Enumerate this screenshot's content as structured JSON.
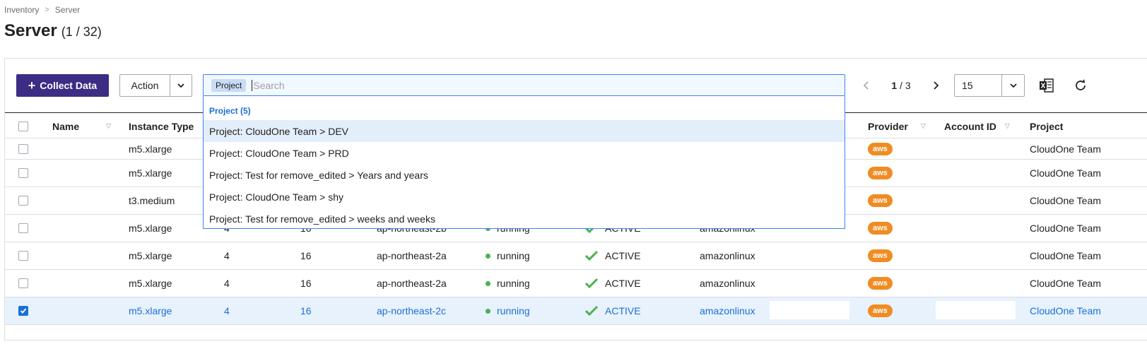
{
  "breadcrumb": [
    "Inventory",
    "Server"
  ],
  "page": {
    "title": "Server",
    "count": "(1 / 32)"
  },
  "toolbar": {
    "collect_label": "Collect Data",
    "action_label": "Action",
    "page_current": "1",
    "page_total": "/ 3",
    "page_size": "15"
  },
  "search": {
    "tag": "Project",
    "placeholder": "Search",
    "dropdown_header": "Project (5)",
    "options": [
      "Project: CloudOne Team > DEV",
      "Project: CloudOne Team > PRD",
      "Project: Test for remove_edited > Years and years",
      "Project: CloudOne Team > shy",
      "Project: Test for remove_edited > weeks and weeks"
    ]
  },
  "columns": {
    "name": "Name",
    "instance_type": "Instance Type",
    "provider": "Provider",
    "account_id": "Account ID",
    "project": "Project"
  },
  "rows": [
    {
      "instance_type": "m5.xlarge",
      "core": "",
      "memory": "",
      "region": "",
      "state": "",
      "lifecycle": "",
      "os": "",
      "provider": "aws",
      "project": "CloudOne Team",
      "checked": false
    },
    {
      "instance_type": "m5.xlarge",
      "core": "",
      "memory": "",
      "region": "",
      "state": "",
      "lifecycle": "",
      "os": "",
      "provider": "aws",
      "project": "CloudOne Team",
      "checked": false
    },
    {
      "instance_type": "t3.medium",
      "core": "",
      "memory": "",
      "region": "",
      "state": "",
      "lifecycle": "",
      "os": "",
      "provider": "aws",
      "project": "CloudOne Team",
      "checked": false
    },
    {
      "instance_type": "m5.xlarge",
      "core": "4",
      "memory": "16",
      "region": "ap-northeast-2b",
      "state": "running",
      "lifecycle": "ACTIVE",
      "os": "amazonlinux",
      "provider": "aws",
      "project": "CloudOne Team",
      "checked": false
    },
    {
      "instance_type": "m5.xlarge",
      "core": "4",
      "memory": "16",
      "region": "ap-northeast-2a",
      "state": "running",
      "lifecycle": "ACTIVE",
      "os": "amazonlinux",
      "provider": "aws",
      "project": "CloudOne Team",
      "checked": false
    },
    {
      "instance_type": "m5.xlarge",
      "core": "4",
      "memory": "16",
      "region": "ap-northeast-2a",
      "state": "running",
      "lifecycle": "ACTIVE",
      "os": "amazonlinux",
      "provider": "aws",
      "project": "CloudOne Team",
      "checked": false
    },
    {
      "instance_type": "m5.xlarge",
      "core": "4",
      "memory": "16",
      "region": "ap-northeast-2c",
      "state": "running",
      "lifecycle": "ACTIVE",
      "os": "amazonlinux",
      "provider": "aws",
      "project": "CloudOne Team",
      "checked": true
    }
  ],
  "colors": {
    "primary": "#3c2c84",
    "accent": "#1a6fd8",
    "status_green": "#4cb050",
    "aws": "#f08c23",
    "selected_row": "#e8f2fd"
  }
}
